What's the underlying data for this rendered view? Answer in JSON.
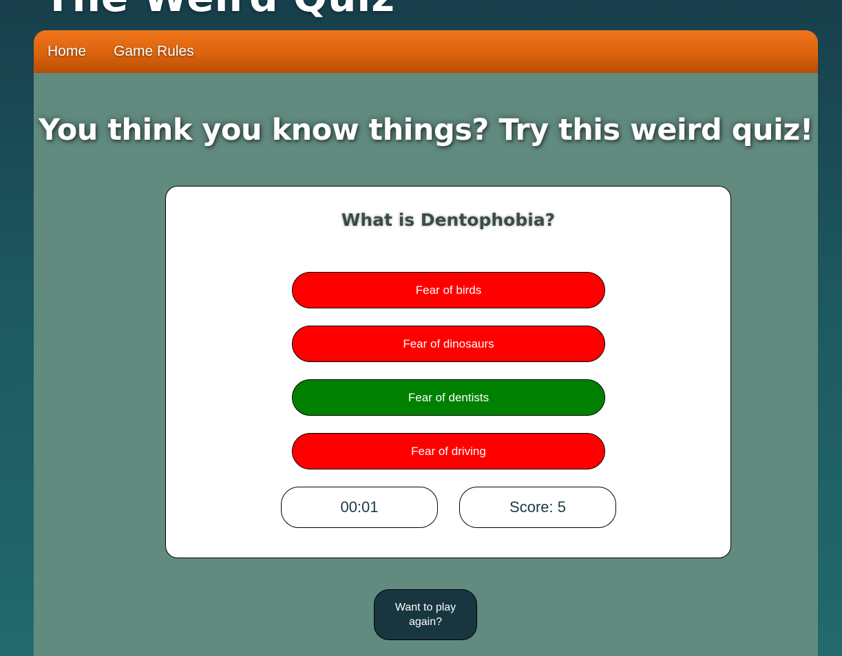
{
  "site": {
    "title": "The Weird Quiz"
  },
  "nav": {
    "items": [
      {
        "label": "Home"
      },
      {
        "label": "Game Rules"
      }
    ]
  },
  "headline": "You think you know things? Try this weird quiz!",
  "quiz": {
    "question": "What is Dentophobia?",
    "answers": [
      {
        "label": "Fear of birds",
        "state": "wrong",
        "color": "#ff0000"
      },
      {
        "label": "Fear of dinosaurs",
        "state": "wrong",
        "color": "#ff0000"
      },
      {
        "label": "Fear of dentists",
        "state": "correct",
        "color": "#008000"
      },
      {
        "label": "Fear of driving",
        "state": "wrong",
        "color": "#ff0000"
      }
    ],
    "timer": "00:01",
    "score": "Score: 5"
  },
  "play_again_label": "Want to play again?",
  "colors": {
    "background": "#1d5860",
    "panel": "#628b80",
    "navbar": "#db6410",
    "play_again_button": "#17363f"
  }
}
